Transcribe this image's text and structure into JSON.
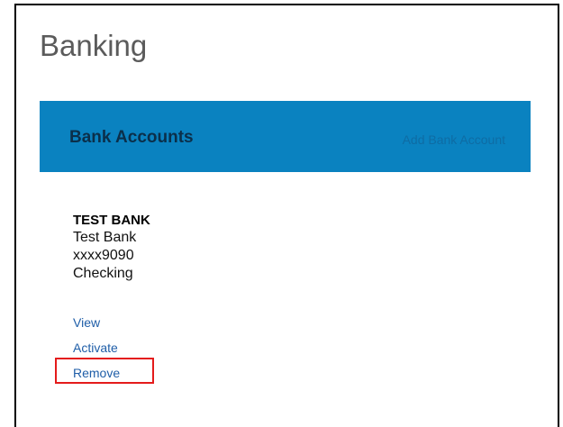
{
  "page": {
    "title": "Banking"
  },
  "bank_accounts": {
    "header_title": "Bank Accounts",
    "add_label": "Add Bank Account",
    "header_color": "#0a82c0",
    "accounts": [
      {
        "name": "TEST BANK",
        "bank": "Test Bank",
        "masked_number": "xxxx9090",
        "type": "Checking",
        "actions": {
          "view": "View",
          "activate": "Activate",
          "remove": "Remove"
        }
      }
    ]
  },
  "highlight_color": "#e41b1b"
}
